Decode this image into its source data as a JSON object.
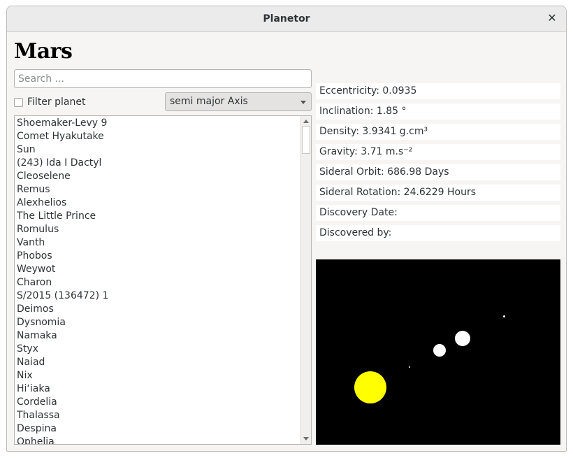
{
  "window": {
    "title": "Planetor",
    "close_symbol": "✕"
  },
  "heading": "Mars",
  "search": {
    "placeholder": "Search ...",
    "value": ""
  },
  "filter": {
    "label": "Filter planet",
    "checked": false
  },
  "sort_combo": {
    "selected": "semi major Axis"
  },
  "bodies_list": [
    "Shoemaker-Levy 9",
    "Comet Hyakutake",
    "Sun",
    "(243) Ida I Dactyl",
    "Cleoselene",
    "Remus",
    "Alexhelios",
    "The Little Prince",
    "Romulus",
    "Vanth",
    "Phobos",
    "Weywot",
    "Charon",
    "S/2015 (136472) 1",
    "Deimos",
    "Dysnomia",
    "Namaka",
    "Styx",
    "Naiad",
    "Nix",
    "Hiʻiaka",
    "Cordelia",
    "Thalassa",
    "Despina",
    "Ophelia"
  ],
  "properties": {
    "eccentricity": "Eccentricity: 0.0935",
    "inclination": "Inclination: 1.85 °",
    "density": "Density: 3.9341 g.cm³",
    "gravity": "Gravity: 3.71 m.s⁻²",
    "sideral_orbit": "Sideral Orbit: 686.98 Days",
    "sideral_rotation": "Sideral Rotation: 24.6229 Hours",
    "discovery_date": "Discovery Date:",
    "discovered_by": "Discovered by:"
  },
  "colors": {
    "canvas_background": "#000000",
    "sun": "#ffff00",
    "planet": "#ffffff"
  }
}
